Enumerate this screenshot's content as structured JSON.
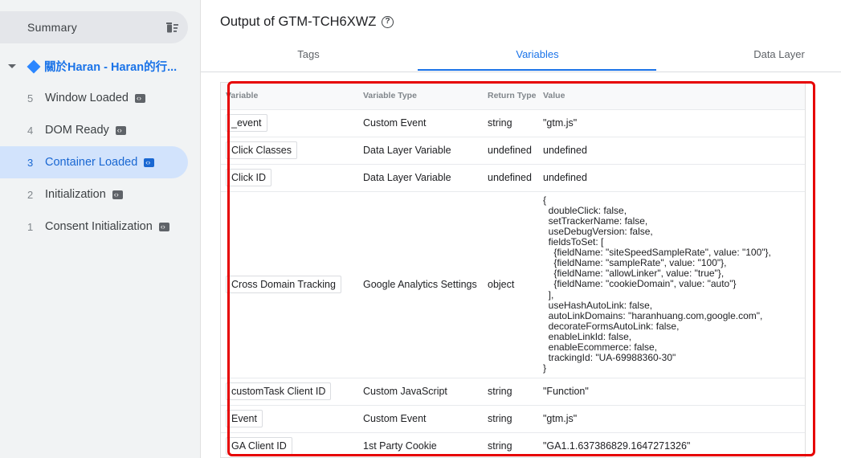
{
  "sidebar": {
    "summary_label": "Summary",
    "group_title": "關於Haran - Haran的行...",
    "events": [
      {
        "num": "5",
        "name": "Window Loaded"
      },
      {
        "num": "4",
        "name": "DOM Ready"
      },
      {
        "num": "3",
        "name": "Container Loaded"
      },
      {
        "num": "2",
        "name": "Initialization"
      },
      {
        "num": "1",
        "name": "Consent Initialization"
      }
    ],
    "active_event": "3"
  },
  "header": {
    "title": "Output of GTM-TCH6XWZ",
    "help_glyph": "?"
  },
  "tabs": [
    "Tags",
    "Variables",
    "Data Layer"
  ],
  "active_tab": "Variables",
  "table": {
    "columns": [
      "Variable",
      "Variable Type",
      "Return Type",
      "Value"
    ],
    "rows": [
      {
        "variable": "_event",
        "type": "Custom Event",
        "return": "string",
        "value": "\"gtm.js\""
      },
      {
        "variable": "Click Classes",
        "type": "Data Layer Variable",
        "return": "undefined",
        "value": "undefined"
      },
      {
        "variable": "Click ID",
        "type": "Data Layer Variable",
        "return": "undefined",
        "value": "undefined"
      },
      {
        "variable": "Cross Domain Tracking",
        "type": "Google Analytics Settings",
        "return": "object",
        "value": "{\n  doubleClick: false,\n  setTrackerName: false,\n  useDebugVersion: false,\n  fieldsToSet: [\n    {fieldName: \"siteSpeedSampleRate\", value: \"100\"},\n    {fieldName: \"sampleRate\", value: \"100\"},\n    {fieldName: \"allowLinker\", value: \"true\"},\n    {fieldName: \"cookieDomain\", value: \"auto\"}\n  ],\n  useHashAutoLink: false,\n  autoLinkDomains: \"haranhuang.com,google.com\",\n  decorateFormsAutoLink: false,\n  enableLinkId: false,\n  enableEcommerce: false,\n  trackingId: \"UA-69988360-30\"\n}"
      },
      {
        "variable": "customTask Client ID",
        "type": "Custom JavaScript",
        "return": "string",
        "value": "\"Function\""
      },
      {
        "variable": "Event",
        "type": "Custom Event",
        "return": "string",
        "value": "\"gtm.js\""
      },
      {
        "variable": "GA Client ID",
        "type": "1st Party Cookie",
        "return": "string",
        "value": "\"GA1.1.637386829.1647271326\""
      }
    ]
  },
  "colors": {
    "accent": "#1a73e8",
    "highlight_box": "#e60000",
    "sidebar_bg": "#f1f3f4",
    "active_row_bg": "#d2e3fc"
  }
}
